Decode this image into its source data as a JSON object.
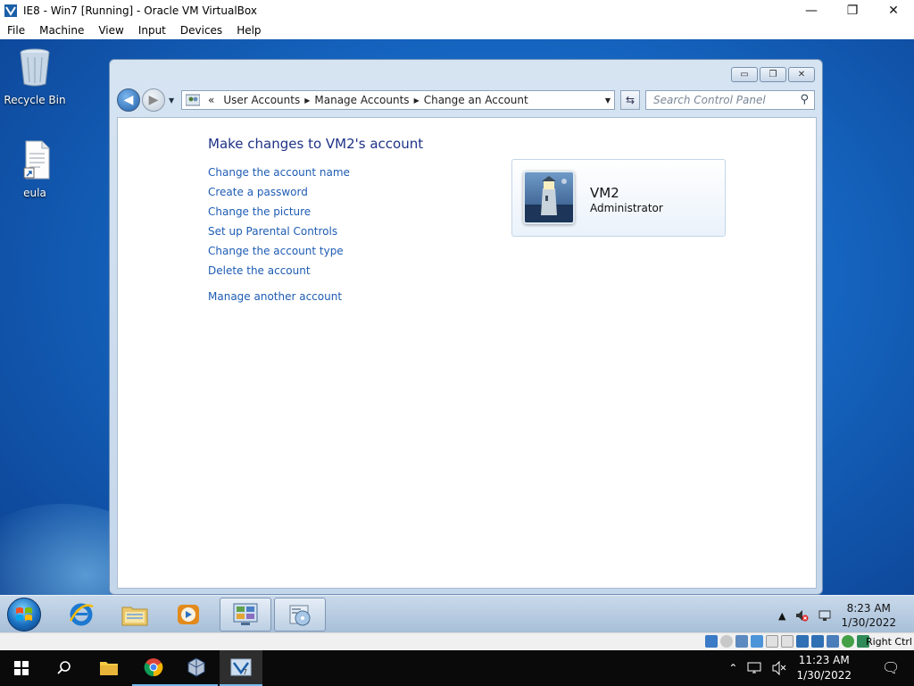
{
  "host_window": {
    "title": "IE8 - Win7 [Running] - Oracle VM VirtualBox",
    "controls": {
      "minimize": "—",
      "maximize": "❐",
      "close": "✕"
    },
    "menu": [
      "File",
      "Machine",
      "View",
      "Input",
      "Devices",
      "Help"
    ]
  },
  "desktop": {
    "icons": [
      {
        "label": "Recycle Bin",
        "icon": "recycle-bin-icon"
      },
      {
        "label": "eula",
        "icon": "document-shortcut-icon"
      }
    ]
  },
  "control_panel": {
    "caption_buttons": {
      "minimize": "▭",
      "restore": "❐",
      "close": "✕"
    },
    "breadcrumb": {
      "overflow": "«",
      "items": [
        "User Accounts",
        "Manage Accounts",
        "Change an Account"
      ]
    },
    "search_placeholder": "Search Control Panel",
    "heading": "Make changes to VM2's account",
    "links": [
      "Change the account name",
      "Create a password",
      "Change the picture",
      "Set up Parental Controls",
      "Change the account type",
      "Delete the account"
    ],
    "secondary_link": "Manage another account",
    "account": {
      "name": "VM2",
      "type": "Administrator",
      "picture": "lighthouse-icon"
    }
  },
  "guest_taskbar": {
    "pinned": [
      "internet-explorer-icon",
      "windows-explorer-icon",
      "media-player-icon",
      "control-panel-icon",
      "program-icon"
    ],
    "clock": {
      "time": "8:23 AM",
      "date": "1/30/2022"
    }
  },
  "vbox_status": {
    "host_key": "Right Ctrl"
  },
  "host_taskbar": {
    "apps": [
      "start-icon",
      "search-icon",
      "file-explorer-icon",
      "chrome-icon",
      "virtualbox-icon",
      "vm-window-icon"
    ],
    "clock": {
      "time": "11:23 AM",
      "date": "1/30/2022"
    }
  },
  "colors": {
    "link": "#1e5cb3",
    "heading": "#1e3287",
    "desktop": "#1565c0"
  }
}
